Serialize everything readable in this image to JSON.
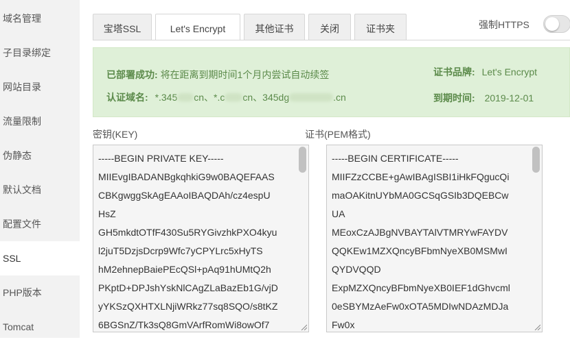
{
  "sidebar": {
    "items": [
      {
        "label": "域名管理"
      },
      {
        "label": "子目录绑定"
      },
      {
        "label": "网站目录"
      },
      {
        "label": "流量限制"
      },
      {
        "label": "伪静态"
      },
      {
        "label": "默认文档"
      },
      {
        "label": "配置文件"
      },
      {
        "label": "SSL"
      },
      {
        "label": "PHP版本"
      },
      {
        "label": "Tomcat"
      }
    ],
    "active": "SSL"
  },
  "tabs": [
    {
      "label": "宝塔SSL"
    },
    {
      "label": "Let's Encrypt"
    },
    {
      "label": "其他证书"
    },
    {
      "label": "关闭"
    },
    {
      "label": "证书夹"
    }
  ],
  "https_toggle": {
    "label": "强制HTTPS",
    "on": false
  },
  "status": {
    "deploy_label": "已部署成功:",
    "deploy_text": "将在距离到期时间1个月内尝试自动续签",
    "domain_label": "认证域名:",
    "domain_parts": [
      "*.345",
      "cn、*.c",
      "cn、345dg",
      ".cn"
    ],
    "brand_label": "证书品牌:",
    "brand_value": "Let's Encrypt",
    "expire_label": "到期时间:",
    "expire_value": "2019-12-01"
  },
  "key": {
    "label": "密钥(KEY)",
    "content": "-----BEGIN PRIVATE KEY-----\nMIIEvgIBADANBgkqhkiG9w0BAQEFAAS\nCBKgwggSkAgEAAoIBAQDAh/cz4espU\nHsZ\nGH5mkdtOTfF430Su5RYGivzhkPXO4kyu\nl2juT5DzjsDcrp9Wfc7yCPYLrc5xHyTS\nhM2ehnepBaiePEcQSl+pAq91hUMtQ2h\nPKptD+DPJshYskNlCAgZLaBazEb1G/vjD\nyYKSzQXHTXLNjiWRkz77sq8SQO/s8tKZ\n6BGSnZ/Tk3sQ8GmVArfRomWi8owOf7"
  },
  "cert": {
    "label": "证书(PEM格式)",
    "content": "-----BEGIN CERTIFICATE-----\nMIIFZzCCBE+gAwIBAgISBI1iHkFQgucQi\nmaOAKitnUYbMA0GCSqGSIb3DQEBCw\nUA\nMEoxCzAJBgNVBAYTAlVTMRYwFAYDV\nQQKEw1MZXQncyBFbmNyeXB0MSMwI\nQYDVQQD\nExpMZXQncyBFbmNyeXB0IEF1dGhvcml\n0eSBYMzAeFw0xOTA5MDIwNDAzMDJa\nFw0x"
  },
  "colors": {
    "panel_bg": "#dff0d8",
    "panel_text": "#5b8a4a",
    "sidebar_bg": "#f2f2f2"
  }
}
